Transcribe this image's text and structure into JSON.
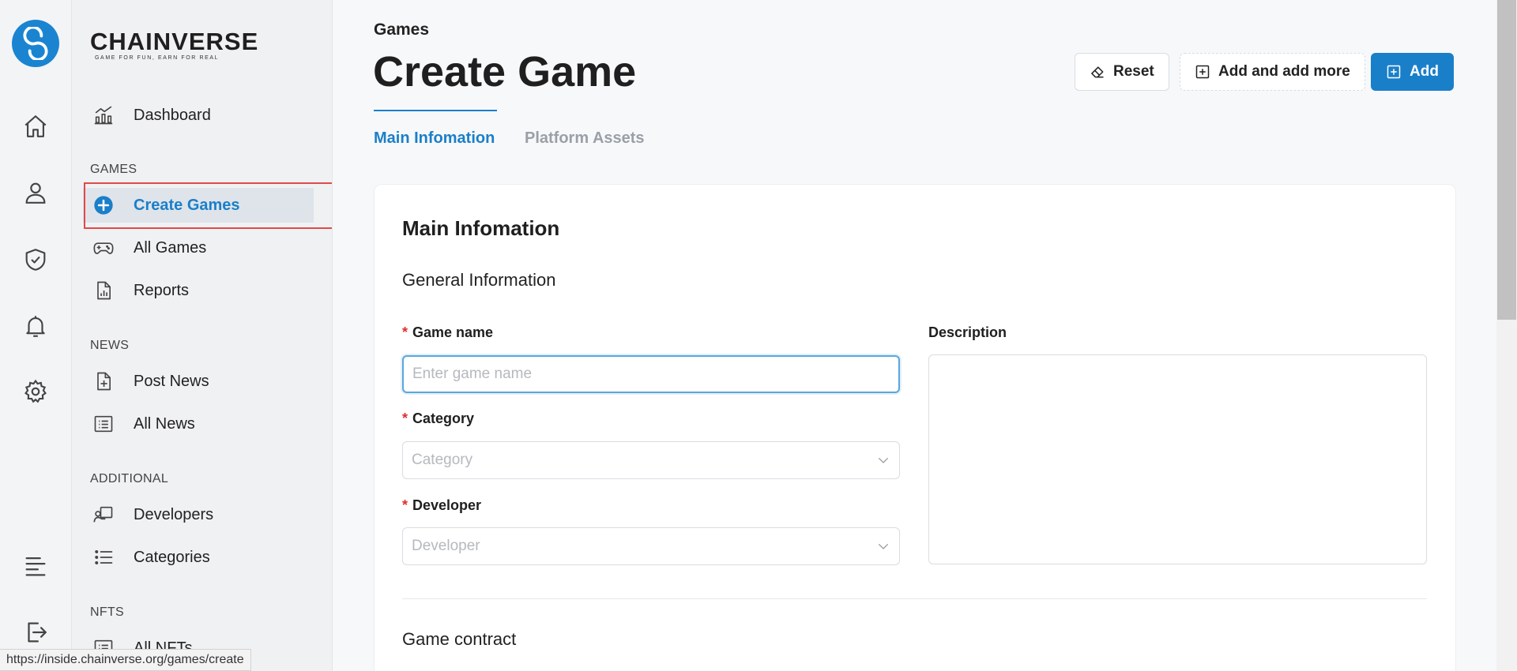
{
  "brand": {
    "name": "CHAINVERSE",
    "tagline": "GAME FOR FUN, EARN FOR REAL",
    "accent": "#1a7fc9"
  },
  "rail": {
    "items": [
      {
        "name": "home-icon"
      },
      {
        "name": "user-icon"
      },
      {
        "name": "shield-check-icon"
      },
      {
        "name": "bell-icon"
      },
      {
        "name": "gear-icon"
      },
      {
        "name": "menu-lines-icon"
      },
      {
        "name": "logout-icon"
      }
    ]
  },
  "sidebar": {
    "dashboard": "Dashboard",
    "sections": {
      "games": "GAMES",
      "news": "NEWS",
      "additional": "ADDITIONAL",
      "nfts": "NFTS"
    },
    "items": {
      "create_games": "Create Games",
      "all_games": "All Games",
      "reports": "Reports",
      "post_news": "Post News",
      "all_news": "All News",
      "developers": "Developers",
      "categories": "Categories",
      "all_nfts": "All NFTs"
    }
  },
  "header": {
    "breadcrumb": "Games",
    "title": "Create Game",
    "tabs": [
      "Main Infomation",
      "Platform Assets"
    ]
  },
  "toolbar": {
    "reset_label": "Reset",
    "add_more_label": "Add and add more",
    "add_label": "Add"
  },
  "form": {
    "card_title": "Main Infomation",
    "general_info": "General Information",
    "required_mark": "*",
    "game_name_label": "Game name",
    "game_name_placeholder": "Enter game name",
    "category_label": "Category",
    "category_placeholder": "Category",
    "developer_label": "Developer",
    "developer_placeholder": "Developer",
    "description_label": "Description",
    "game_contract": "Game contract"
  },
  "status_bar": {
    "url": "https://inside.chainverse.org/games/create"
  }
}
